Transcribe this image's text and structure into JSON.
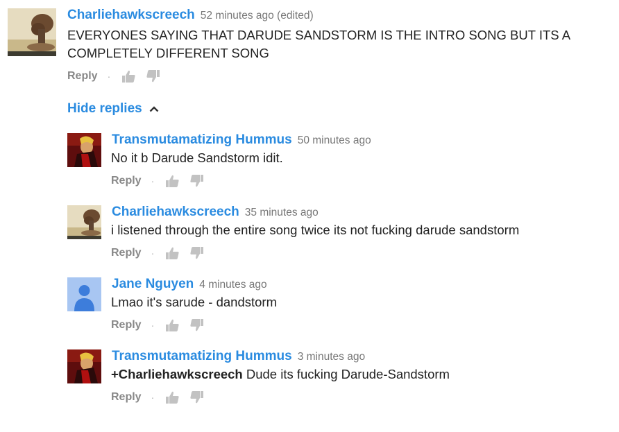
{
  "top_comment": {
    "author": "Charliehawkscreech",
    "time": "52 minutes ago (edited)",
    "text_line1": "EVERYONES SAYING THAT DARUDE SANDSTORM IS THE INTRO SONG BUT ITS A",
    "text_line2": "COMPLETELY DIFFERENT SONG",
    "reply_label": "Reply",
    "separator": "·"
  },
  "hide_replies_label": "Hide replies",
  "replies": [
    {
      "author": "Transmutamatizing Hummus",
      "time": "50 minutes ago",
      "mention": "",
      "text": "No it b Darude Sandstorm idit.",
      "reply_label": "Reply",
      "separator": "·"
    },
    {
      "author": "Charliehawkscreech",
      "time": "35 minutes ago",
      "mention": "",
      "text": "i listened through the entire song twice its not fucking darude sandstorm",
      "reply_label": "Reply",
      "separator": "·"
    },
    {
      "author": "Jane Nguyen",
      "time": "4 minutes ago",
      "mention": "",
      "text": "Lmao it's sarude - dandstorm",
      "reply_label": "Reply",
      "separator": "·"
    },
    {
      "author": "Transmutamatizing Hummus",
      "time": "3 minutes ago",
      "mention": "+Charliehawkscreech",
      "text": " Dude its fucking Darude-Sandstorm",
      "reply_label": "Reply",
      "separator": "·"
    }
  ],
  "colors": {
    "author_link": "#2a8be0",
    "time": "#777777",
    "body_text": "#222222",
    "action": "#888888"
  },
  "icons": [
    "thumbs-up-icon",
    "thumbs-down-icon",
    "chevron-up-icon"
  ]
}
